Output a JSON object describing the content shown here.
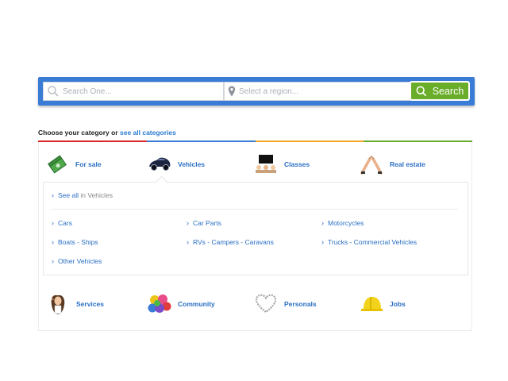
{
  "search": {
    "query_placeholder": "Search One...",
    "region_placeholder": "Select a region...",
    "button_label": "Search"
  },
  "categories_header": {
    "prefix": "Choose your category or",
    "link": "see all categories"
  },
  "color_bar": [
    "#d8262d",
    "#3a7bd5",
    "#f6a626",
    "#6aad2a"
  ],
  "top_categories": [
    {
      "label": "For sale",
      "icon": "money-icon"
    },
    {
      "label": "Vehicles",
      "icon": "car-icon"
    },
    {
      "label": "Classes",
      "icon": "classroom-icon"
    },
    {
      "label": "Real estate",
      "icon": "house-hands-icon"
    }
  ],
  "subcategories": {
    "see_all_link": "See all",
    "see_all_suffix": "in Vehicles",
    "items": [
      "Cars",
      "Car Parts",
      "Motorcycles",
      "Boats - Ships",
      "RVs - Campers - Caravans",
      "Trucks - Commercial Vehicles",
      "Other Vehicles"
    ]
  },
  "bottom_categories": [
    {
      "label": "Services",
      "icon": "person-icon"
    },
    {
      "label": "Community",
      "icon": "balloons-icon"
    },
    {
      "label": "Personals",
      "icon": "heart-icon"
    },
    {
      "label": "Jobs",
      "icon": "hard-hat-icon"
    }
  ]
}
